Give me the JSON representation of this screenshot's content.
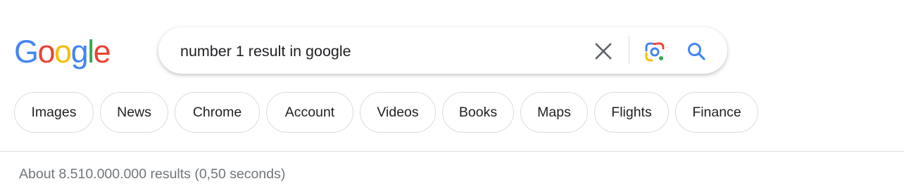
{
  "logo": {
    "letters": [
      "G",
      "o",
      "o",
      "g",
      "l",
      "e"
    ]
  },
  "search": {
    "query": "number 1 result in google",
    "clear_icon": "close-icon",
    "lens_icon": "camera-lens-icon",
    "search_icon": "search-icon"
  },
  "chips": [
    {
      "label": "Images"
    },
    {
      "label": "News"
    },
    {
      "label": "Chrome"
    },
    {
      "label": "Account"
    },
    {
      "label": "Videos"
    },
    {
      "label": "Books"
    },
    {
      "label": "Maps"
    },
    {
      "label": "Flights"
    },
    {
      "label": "Finance"
    }
  ],
  "result_stats": "About 8.510.000.000 results (0,50 seconds)",
  "colors": {
    "blue": "#4285F4",
    "red": "#EA4335",
    "yellow": "#FBBC05",
    "green": "#34A853",
    "text": "#202124",
    "muted": "#70757a",
    "border": "#dadce0"
  }
}
